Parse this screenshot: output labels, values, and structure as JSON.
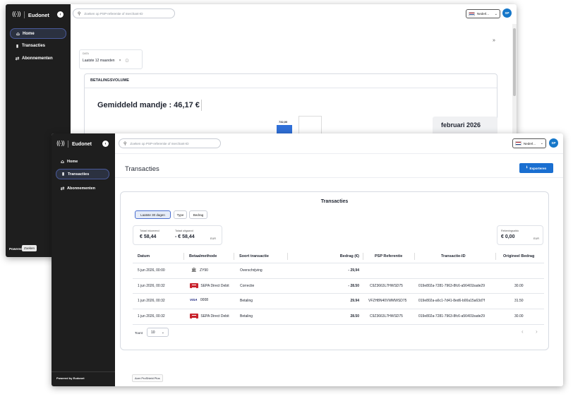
{
  "back": {
    "brand": "Eudonet",
    "nav": [
      {
        "icon": "home-icon",
        "glyph": "⌂",
        "label": "Home",
        "active": true
      },
      {
        "icon": "bar-chart-icon",
        "glyph": "▮",
        "label": "Transacties",
        "active": false
      },
      {
        "icon": "repeat-icon",
        "glyph": "⇄",
        "label": "Abonnementen",
        "active": false
      }
    ],
    "powered_by": "Powered by",
    "tooltip": "Zoeken",
    "search_placeholder": "Zoeken op PSP-referentie of merchant-ID",
    "language": "Nederl...",
    "avatar": "SP",
    "expand_glyph": "»",
    "filter": {
      "label": "DATA",
      "value": "Laatste 12 maanden"
    },
    "panel_title": "BETALINGSVOLUME",
    "avg_basket": "Gemiddeld mandje : 46,17 €",
    "bar_label": "732,00",
    "tooltip_month": "februari 2026"
  },
  "front": {
    "brand": "Eudonet",
    "nav": [
      {
        "icon": "home-icon",
        "glyph": "⌂",
        "label": "Home",
        "active": false
      },
      {
        "icon": "bar-chart-icon",
        "glyph": "▮",
        "label": "Transacties",
        "active": true
      },
      {
        "icon": "repeat-icon",
        "glyph": "⇄",
        "label": "Abonnementen",
        "active": false
      }
    ],
    "powered_by": "Powered by Eudonet",
    "search_placeholder": "Zoeken op PSP-referentie of merchant-ID",
    "language": "Nederl...",
    "avatar": "SP",
    "page_title": "Transacties",
    "export_label": "Exporteren",
    "card_title": "Transacties",
    "filters": [
      {
        "label": "Laatste 30 dagen",
        "active": true
      },
      {
        "label": "Type",
        "active": false
      },
      {
        "label": "Bedrag",
        "active": false
      }
    ],
    "summary": {
      "incoming_label": "Totaal inkomend",
      "incoming_value": "€ 58,44",
      "outgoing_label": "Totaal uitgaand",
      "outgoing_value": "- € 58,44",
      "currency": "EUR",
      "balance_label": "Rekeningsaldo",
      "balance_value": "€ 0,00",
      "balance_currency": "EUR"
    },
    "columns": [
      "Datum",
      "Betaalmethode",
      "Soort transactie",
      "Bedrag (€)",
      "PSP Referentie",
      "Transactie-ID",
      "Origineel Bedrag"
    ],
    "rows": [
      {
        "date": "5 jun 2026, 00:00",
        "method_type": "bank",
        "method": "ZY90",
        "type": "Overschrijving",
        "amount": "- 29,94",
        "psp": "",
        "txid": "",
        "original": ""
      },
      {
        "date": "1 jun 2026, 00:32",
        "method_type": "sepa",
        "method": "SEPA Direct Debit",
        "type": "Correctie",
        "amount": "- 28.50",
        "psp": "C9Z3663L7HWSD75",
        "txid": "019e802a-7281-7963-8fc6-a56401bade29",
        "original": "30.00"
      },
      {
        "date": "1 jun 2026, 00:32",
        "method_type": "visa",
        "method": "0008",
        "type": "Betaling",
        "amount": "29.94",
        "psp": "VFZH8N40VWMWSD75",
        "txid": "019e802a-a6c1-7d41-8ed6-b00a15a63d7f",
        "original": "31.50"
      },
      {
        "date": "1 jun 2026, 00:32",
        "method_type": "sepa",
        "method": "SEPA Direct Debit",
        "type": "Betaling",
        "amount": "28.50",
        "psp": "C9Z3663L7HWSD75",
        "txid": "019e802a-7281-7963-8fc6-a56401bade29",
        "original": "30.00"
      }
    ],
    "visa_text": "VISA",
    "page_size_label": "Toont",
    "page_size": "10",
    "prev_glyph": "‹",
    "next_glyph": "›",
    "footer_tag": "Acer ProShield Plus"
  },
  "colors": {
    "sidebar": "#1e1e1e",
    "accent": "#1a6fd1",
    "chart_bar": "#2f6fd8"
  }
}
